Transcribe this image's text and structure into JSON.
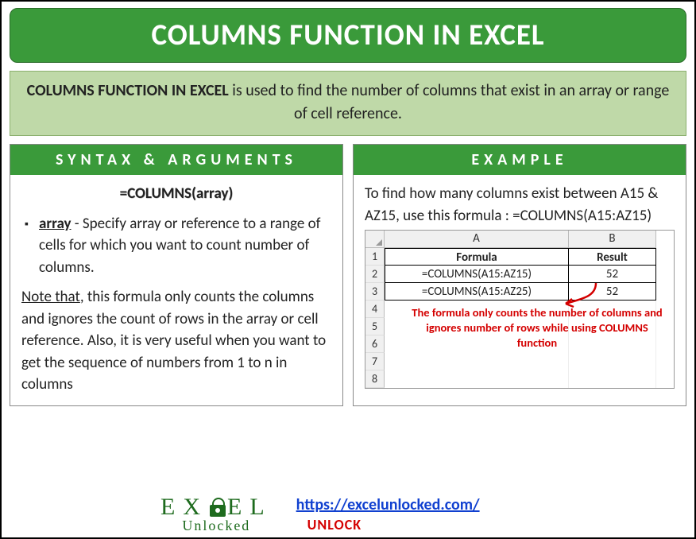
{
  "title": "COLUMNS FUNCTION IN EXCEL",
  "description": {
    "bold": "COLUMNS FUNCTION IN EXCEL",
    "rest": " is used to find the number of columns that exist in an array or range of cell reference."
  },
  "left": {
    "heading": "SYNTAX & ARGUMENTS",
    "formula": "=COLUMNS(array)",
    "arg_name": "array",
    "arg_text": " - Specify array or reference to a range of cells for which you want to count number of columns.",
    "note_lead": "Note that",
    "note_rest": ", this formula only counts the columns and ignores the count of rows in the array or cell reference. Also, it is very useful when you want to get the sequence of numbers from 1 to n in columns"
  },
  "right": {
    "heading": "EXAMPLE",
    "intro": "To find how many columns exist between A15 & AZ15, use this formula : =COLUMNS(A15:AZ15)",
    "table": {
      "col_a": "A",
      "col_b": "B",
      "head_a": "Formula",
      "head_b": "Result",
      "rows": [
        {
          "a": "=COLUMNS(A15:AZ15)",
          "b": "52"
        },
        {
          "a": "=COLUMNS(A15:AZ25)",
          "b": "52"
        }
      ],
      "rownums": [
        "1",
        "2",
        "3",
        "4",
        "5",
        "6",
        "7",
        "8"
      ]
    },
    "callout": "The formula only counts the number of columns and ignores number of rows while using COLUMNS function"
  },
  "footer": {
    "logo_top_left": "EX",
    "logo_top_right": "EL",
    "logo_sub": "Unlocked",
    "link": "https://excelunlocked.com/",
    "unlock": "UNLOCK"
  },
  "chart_data": {
    "type": "table",
    "title": "COLUMNS function example",
    "columns": [
      "Formula",
      "Result"
    ],
    "rows": [
      [
        "=COLUMNS(A15:AZ15)",
        52
      ],
      [
        "=COLUMNS(A15:AZ25)",
        52
      ]
    ]
  }
}
